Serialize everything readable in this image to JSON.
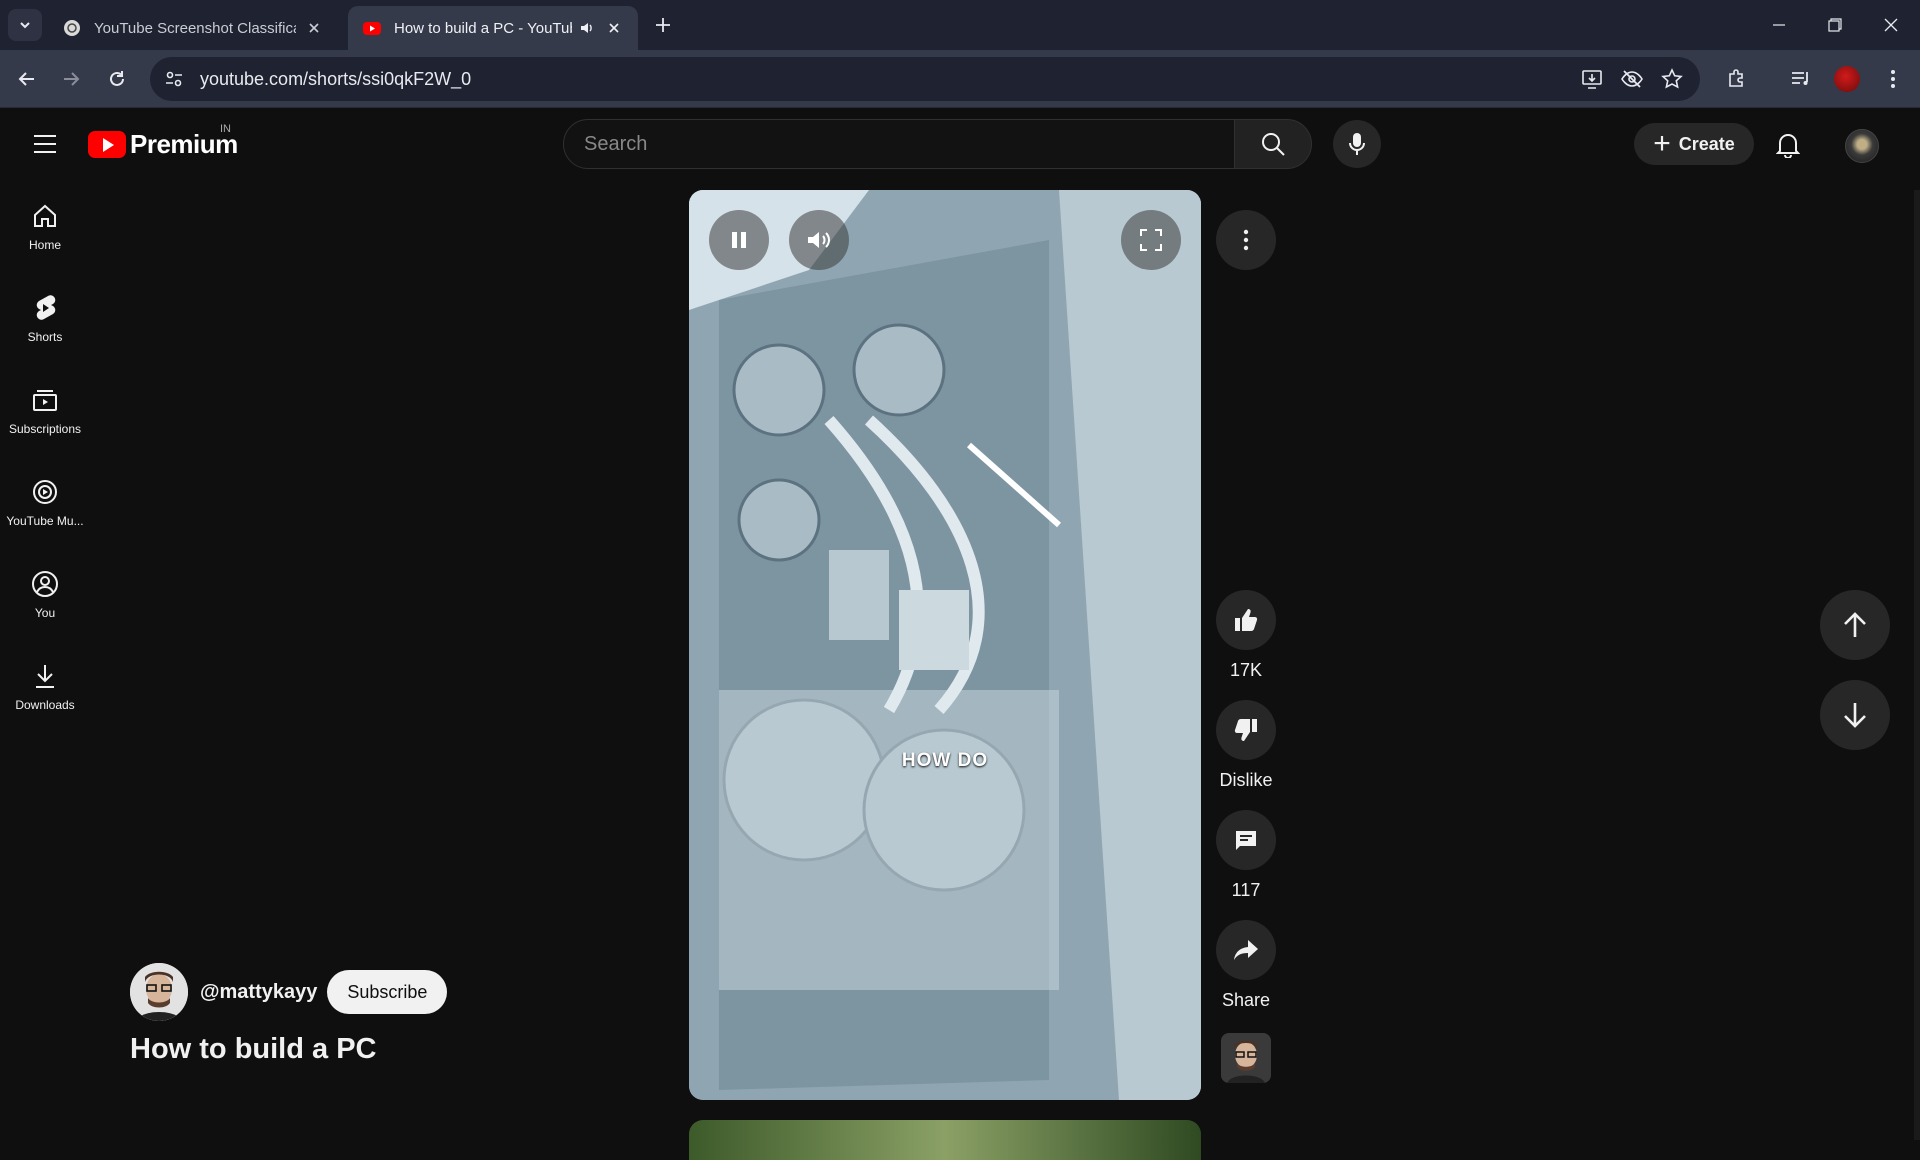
{
  "browser": {
    "tabs": [
      {
        "title": "YouTube Screenshot Classificati",
        "active": false
      },
      {
        "title": "How to build a PC - YouTub",
        "active": true
      }
    ],
    "url": "youtube.com/shorts/ssi0qkF2W_0"
  },
  "header": {
    "logo_text": "Premium",
    "region": "IN",
    "search_placeholder": "Search",
    "create_label": "Create"
  },
  "sidebar": {
    "items": [
      {
        "label": "Home",
        "icon": "home-icon"
      },
      {
        "label": "Shorts",
        "icon": "shorts-icon"
      },
      {
        "label": "Subscriptions",
        "icon": "subscriptions-icon"
      },
      {
        "label": "YouTube Mu...",
        "icon": "youtube-music-icon"
      },
      {
        "label": "You",
        "icon": "you-icon"
      },
      {
        "label": "Downloads",
        "icon": "download-icon"
      }
    ]
  },
  "short": {
    "caption": "HOW DO",
    "channel_handle": "@mattykayy",
    "subscribe_label": "Subscribe",
    "title": "How to build a PC",
    "likes": "17K",
    "dislike_label": "Dislike",
    "comments": "117",
    "share_label": "Share"
  },
  "colors": {
    "brand_red": "#ff0000",
    "background": "#0f0f0f",
    "chip": "#272727"
  }
}
